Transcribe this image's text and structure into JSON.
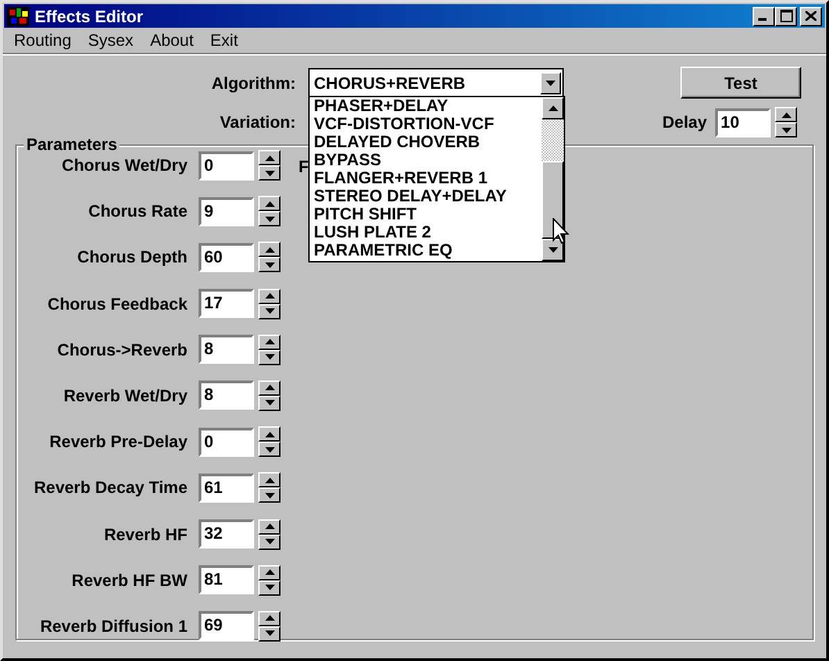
{
  "window": {
    "title": "Effects Editor"
  },
  "menu": [
    "Routing",
    "Sysex",
    "About",
    "Exit"
  ],
  "algorithm": {
    "label": "Algorithm:",
    "value": "CHORUS+REVERB",
    "expanded": true,
    "options": [
      "PHASER+DELAY",
      "VCF-DISTORTION-VCF",
      "DELAYED CHOVERB",
      "BYPASS",
      "FLANGER+REVERB 1",
      "STEREO DELAY+DELAY",
      "PITCH SHIFT",
      "LUSH PLATE 2",
      "PARAMETRIC EQ"
    ]
  },
  "variation": {
    "label": "Variation:"
  },
  "test_button": "Test",
  "delay": {
    "label": "Delay",
    "value": "10"
  },
  "parameters": {
    "title": "Parameters",
    "rows": [
      {
        "label": "Chorus Wet/Dry",
        "value": "0"
      },
      {
        "label": "Chorus Rate",
        "value": "9"
      },
      {
        "label": "Chorus Depth",
        "value": "60"
      },
      {
        "label": "Chorus Feedback",
        "value": "17"
      },
      {
        "label": "Chorus->Reverb",
        "value": "8"
      },
      {
        "label": "Reverb Wet/Dry",
        "value": "8"
      },
      {
        "label": "Reverb Pre-Delay",
        "value": "0"
      },
      {
        "label": "Reverb Decay Time",
        "value": "61"
      },
      {
        "label": "Reverb HF",
        "value": "32"
      },
      {
        "label": "Reverb HF BW",
        "value": "81"
      },
      {
        "label": "Reverb Diffusion 1",
        "value": "69"
      }
    ],
    "column_2_label": "F"
  }
}
